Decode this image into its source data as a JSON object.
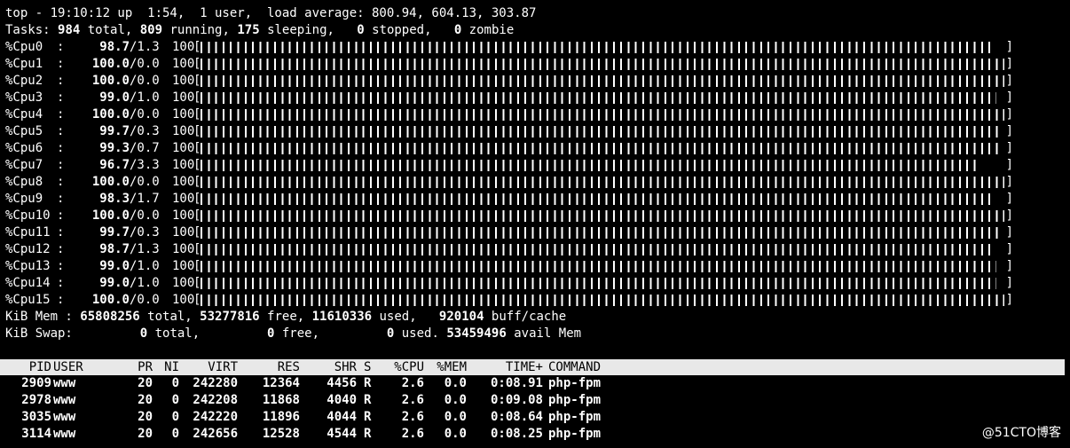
{
  "top": {
    "line1": "top - 19:10:12 up  1:54,  1 user,  load average: 800.94, 604.13, 303.87",
    "tasks": {
      "prefix": "Tasks: ",
      "total": "984",
      "total_label": " total, ",
      "running": "809",
      "running_label": " running, ",
      "sleeping": "175",
      "sleeping_label": " sleeping,   ",
      "stopped": "0",
      "stopped_label": " stopped,   ",
      "zombie": "0",
      "zombie_label": " zombie"
    },
    "cpus": [
      {
        "label": "%Cpu0",
        "us": "98.7",
        "sy": "/1.3",
        "max": "100",
        "usage": 98.7
      },
      {
        "label": "%Cpu1",
        "us": "100.0",
        "sy": "/0.0",
        "max": "100",
        "usage": 100.0
      },
      {
        "label": "%Cpu2",
        "us": "100.0",
        "sy": "/0.0",
        "max": "100",
        "usage": 100.0
      },
      {
        "label": "%Cpu3",
        "us": "99.0",
        "sy": "/1.0",
        "max": "100",
        "usage": 99.0
      },
      {
        "label": "%Cpu4",
        "us": "100.0",
        "sy": "/0.0",
        "max": "100",
        "usage": 100.0
      },
      {
        "label": "%Cpu5",
        "us": "99.7",
        "sy": "/0.3",
        "max": "100",
        "usage": 99.7
      },
      {
        "label": "%Cpu6",
        "us": "99.3",
        "sy": "/0.7",
        "max": "100",
        "usage": 99.3
      },
      {
        "label": "%Cpu7",
        "us": "96.7",
        "sy": "/3.3",
        "max": "100",
        "usage": 96.7
      },
      {
        "label": "%Cpu8",
        "us": "100.0",
        "sy": "/0.0",
        "max": "100",
        "usage": 100.0
      },
      {
        "label": "%Cpu9",
        "us": "98.3",
        "sy": "/1.7",
        "max": "100",
        "usage": 98.3
      },
      {
        "label": "%Cpu10",
        "us": "100.0",
        "sy": "/0.0",
        "max": "100",
        "usage": 100.0
      },
      {
        "label": "%Cpu11",
        "us": "99.7",
        "sy": "/0.3",
        "max": "100",
        "usage": 99.7
      },
      {
        "label": "%Cpu12",
        "us": "98.7",
        "sy": "/1.3",
        "max": "100",
        "usage": 98.7
      },
      {
        "label": "%Cpu13",
        "us": "99.0",
        "sy": "/1.0",
        "max": "100",
        "usage": 99.0
      },
      {
        "label": "%Cpu14",
        "us": "99.0",
        "sy": "/1.0",
        "max": "100",
        "usage": 99.0
      },
      {
        "label": "%Cpu15",
        "us": "100.0",
        "sy": "/0.0",
        "max": "100",
        "usage": 100.0
      }
    ],
    "mem": {
      "prefix": "KiB Mem : ",
      "total": "65808256",
      "total_label": " total, ",
      "free": "53277816",
      "free_label": " free, ",
      "used": "11610336",
      "used_label": " used,   ",
      "buff": "920104",
      "buff_label": " buff/cache"
    },
    "swap": {
      "prefix": "KiB Swap:         ",
      "total": "0",
      "total_label": " total,         ",
      "free": "0",
      "free_label": " free,         ",
      "used": "0",
      "used_label": " used. ",
      "avail": "53459496",
      "avail_label": " avail Mem"
    },
    "columns": [
      "PID",
      "USER",
      "PR",
      "NI",
      "VIRT",
      "RES",
      "SHR",
      "S",
      "%CPU",
      "%MEM",
      "TIME+",
      "COMMAND"
    ],
    "processes": [
      [
        "2909",
        "www",
        "20",
        "0",
        "242280",
        "12364",
        "4456",
        "R",
        "2.6",
        "0.0",
        "0:08.91",
        "php-fpm"
      ],
      [
        "2978",
        "www",
        "20",
        "0",
        "242208",
        "11868",
        "4040",
        "R",
        "2.6",
        "0.0",
        "0:09.08",
        "php-fpm"
      ],
      [
        "3035",
        "www",
        "20",
        "0",
        "242220",
        "11896",
        "4044",
        "R",
        "2.6",
        "0.0",
        "0:08.64",
        "php-fpm"
      ],
      [
        "3114",
        "www",
        "20",
        "0",
        "242656",
        "12528",
        "4544",
        "R",
        "2.6",
        "0.0",
        "0:08.25",
        "php-fpm"
      ]
    ]
  },
  "watermark": "@51CTO博客"
}
